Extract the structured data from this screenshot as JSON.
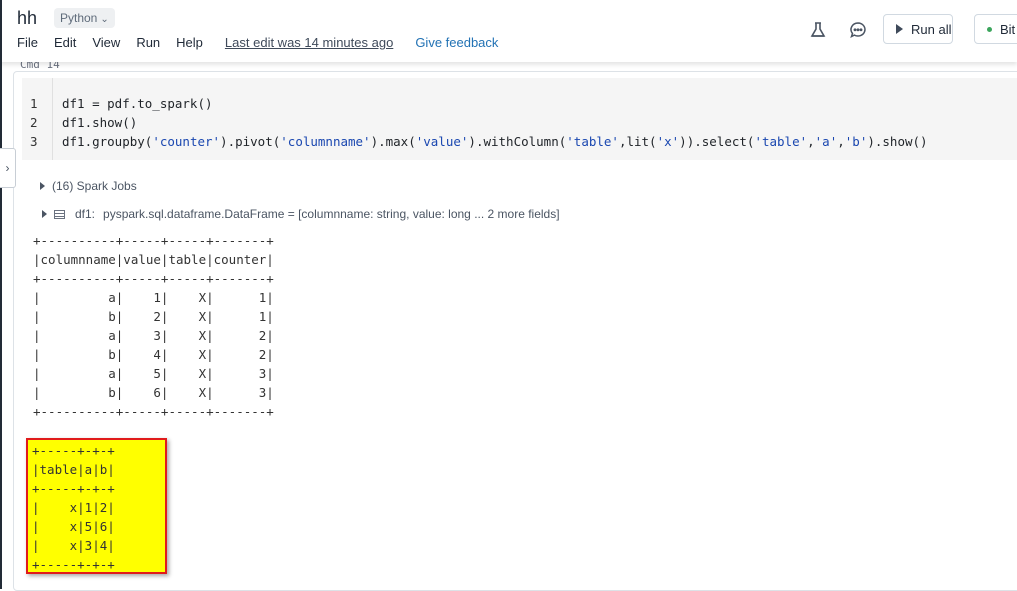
{
  "header": {
    "notebook_title": "hh",
    "language": "Python",
    "menu": [
      "File",
      "Edit",
      "View",
      "Run",
      "Help"
    ],
    "last_edit": "Last edit was 14 minutes ago",
    "feedback": "Give feedback",
    "icons": [
      "experiment-icon",
      "comment-icon"
    ],
    "run_all_label": "Run all",
    "cluster_label": "Bit",
    "cluster_status_color": "#3ba55c"
  },
  "cell": {
    "cmd_label": "Cmd 14",
    "line_numbers": [
      "1",
      "2",
      "3"
    ],
    "code_lines": [
      "df1 = pdf.to_spark()",
      "df1.show()",
      "df1.groupby('counter').pivot('columnname').max('value').withColumn('table',lit('x')).select('table','a','b').show()"
    ],
    "spark_jobs": "(16) Spark Jobs",
    "df_name": "df1:",
    "df_schema": "pyspark.sql.dataframe.DataFrame = [columnname: string, value: long ... 2 more fields]"
  },
  "output1": {
    "columns": [
      "columnname",
      "value",
      "table",
      "counter"
    ],
    "rows": [
      [
        "a",
        "1",
        "X",
        "1"
      ],
      [
        "b",
        "2",
        "X",
        "1"
      ],
      [
        "a",
        "3",
        "X",
        "2"
      ],
      [
        "b",
        "4",
        "X",
        "2"
      ],
      [
        "a",
        "5",
        "X",
        "3"
      ],
      [
        "b",
        "6",
        "X",
        "3"
      ]
    ]
  },
  "output2": {
    "columns": [
      "table",
      "a",
      "b"
    ],
    "rows": [
      [
        "x",
        "1",
        "2"
      ],
      [
        "x",
        "5",
        "6"
      ],
      [
        "x",
        "3",
        "4"
      ]
    ],
    "highlight_color": "#ffff00",
    "highlight_border": "#e01b1b"
  }
}
